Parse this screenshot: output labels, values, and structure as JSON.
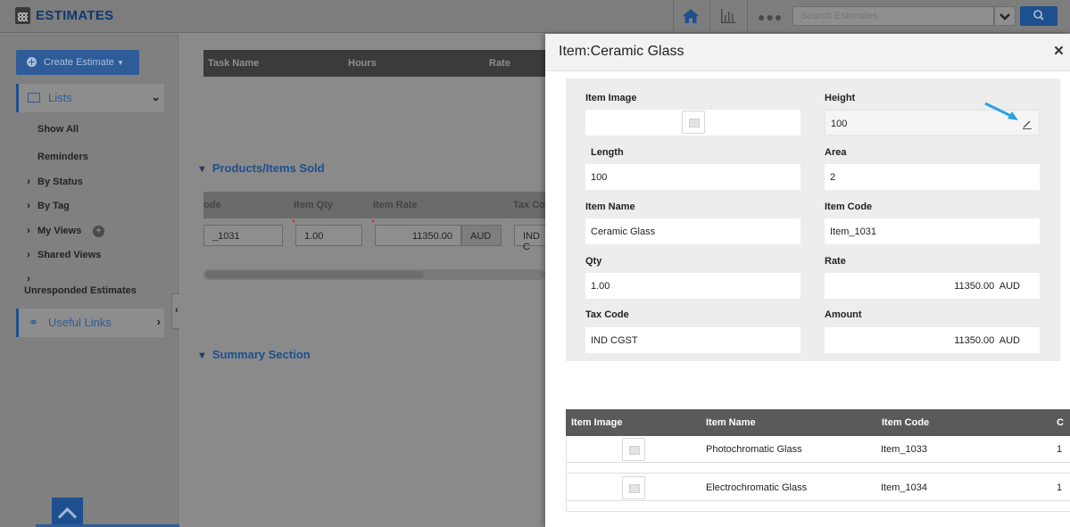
{
  "app": {
    "title": "ESTIMATES"
  },
  "search": {
    "placeholder": "Search Estimates"
  },
  "sidebar": {
    "create_label": "Create Estimate",
    "lists_label": "Lists",
    "items": [
      "Show All",
      "Reminders"
    ],
    "groups": [
      "By Status",
      "By Tag",
      "My Views",
      "Shared Views",
      "Unresponded Estimates"
    ],
    "useful_links_label": "Useful Links"
  },
  "main": {
    "task_columns": [
      "Task Name",
      "Hours",
      "Rate"
    ],
    "products_title": "Products/Items Sold",
    "item_columns": [
      "ode",
      "Item Qty",
      "Item Rate",
      "Tax Co"
    ],
    "row": {
      "code": "_1031",
      "qty": "1.00",
      "rate": "11350.00",
      "currency": "AUD",
      "tax": "IND C"
    },
    "summary_title": "Summary Section"
  },
  "panel": {
    "title": "Item:Ceramic Glass",
    "close": "×",
    "fields": {
      "item_image_label": "Item Image",
      "height_label": "Height",
      "height_value": "100",
      "length_label": "Length",
      "length_value": "100",
      "area_label": "Area",
      "area_value": "2",
      "item_name_label": "Item Name",
      "item_name_value": "Ceramic Glass",
      "item_code_label": "Item Code",
      "item_code_value": "Item_1031",
      "qty_label": "Qty",
      "qty_value": "1.00",
      "rate_label": "Rate",
      "rate_value": "11350.00  AUD",
      "tax_code_label": "Tax Code",
      "tax_code_value": "IND CGST",
      "amount_label": "Amount",
      "amount_value": "11350.00  AUD"
    },
    "table": {
      "columns": [
        "Item Image",
        "Item Name",
        "Item Code",
        "C"
      ],
      "rows": [
        {
          "name": "Photochromatic Glass",
          "code": "Item_1033",
          "extra": "1"
        },
        {
          "name": "Electrochromatic Glass",
          "code": "Item_1034",
          "extra": "1"
        }
      ]
    }
  },
  "colors": {
    "accent": "#1e4f8e",
    "pointer_arrow": "#2aa3e0"
  }
}
